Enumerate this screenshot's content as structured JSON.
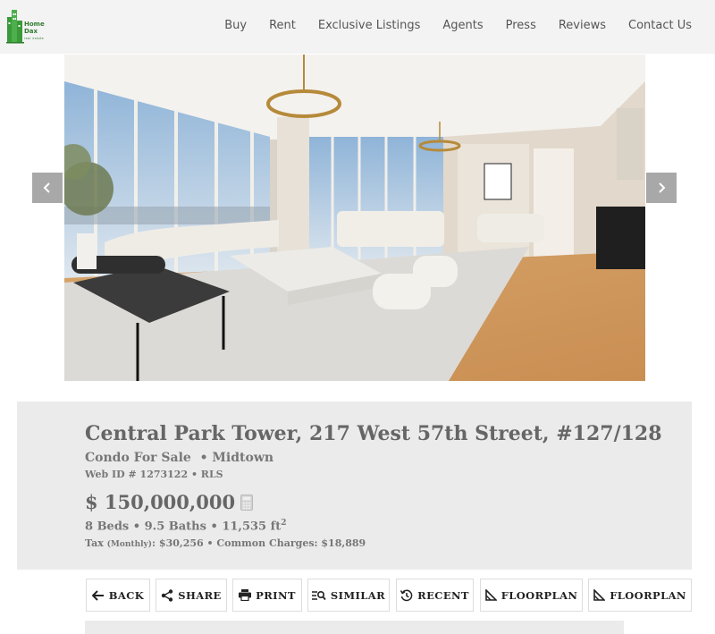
{
  "header": {
    "logo": {
      "name_line1": "Home",
      "name_line2": "Dax",
      "tagline": "real estate"
    },
    "nav": [
      "Buy",
      "Rent",
      "Exclusive Listings",
      "Agents",
      "Press",
      "Reviews",
      "Contact Us"
    ]
  },
  "gallery": {
    "prev_icon": "chevron-left-icon",
    "next_icon": "chevron-right-icon"
  },
  "listing": {
    "title": "Central Park Tower, 217 West 57th Street, #127/128",
    "type": "Condo For Sale",
    "neighborhood": "Midtown",
    "web_id": "Web ID # 1273122 • RLS",
    "price": "$ 150,000,000",
    "beds": "8 Beds",
    "baths": "9.5 Baths",
    "area": "11,535 ft",
    "area_unit_exp": "2",
    "tax_label": "Tax",
    "tax_period": "(Monthly)",
    "tax_value": ": $30,256",
    "common_charges": "Common Charges: $18,889"
  },
  "actions": [
    {
      "label": "BACK",
      "icon": "arrow-left-icon"
    },
    {
      "label": "SHARE",
      "icon": "share-icon"
    },
    {
      "label": "PRINT",
      "icon": "printer-icon"
    },
    {
      "label": "SIMILAR",
      "icon": "similar-search-icon"
    },
    {
      "label": "RECENT",
      "icon": "history-icon"
    },
    {
      "label": "FLOORPLAN",
      "icon": "floorplan-icon"
    },
    {
      "label": "FLOORPLAN",
      "icon": "floorplan-icon"
    }
  ],
  "colors": {
    "header_bg": "#f3f3f3",
    "panel_bg": "#ebebeb",
    "logo_green": "#2f7d2f",
    "arrow_bg": "#a8a8a8"
  }
}
